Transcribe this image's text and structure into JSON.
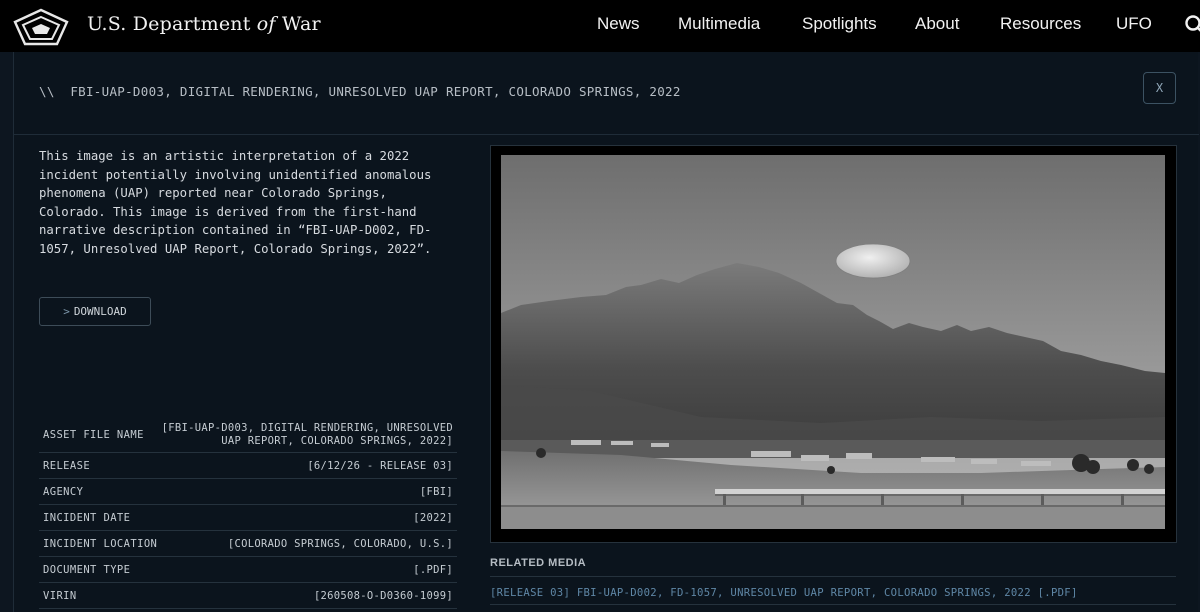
{
  "site": {
    "title_prefix": "U.S. Department ",
    "title_of": "of",
    "title_suffix": " War"
  },
  "nav": {
    "items": [
      "News",
      "Multimedia",
      "Spotlights",
      "About",
      "Resources",
      "UFO"
    ],
    "search_icon": "search-icon"
  },
  "modal": {
    "title_prefix": "\\\\",
    "title": "FBI-UAP-D003, DIGITAL RENDERING, UNRESOLVED UAP REPORT, COLORADO SPRINGS, 2022",
    "close_label": "X",
    "description": "This image is an artistic interpretation of a 2022 incident potentially involving unidentified anomalous phenomena (UAP) reported near Colorado Springs, Colorado. This image is derived from the first-hand narrative description contained in “FBI-UAP-D002, FD-1057, Unresolved UAP Report, Colorado Springs, 2022”.",
    "download_label": "DOWNLOAD",
    "download_chevron": ">",
    "metadata": [
      {
        "label": "ASSET FILE NAME",
        "value": "[FBI-UAP-D003, DIGITAL RENDERING, UNRESOLVED UAP REPORT, COLORADO SPRINGS, 2022]"
      },
      {
        "label": "RELEASE",
        "value": "[6/12/26 - RELEASE 03]"
      },
      {
        "label": "AGENCY",
        "value": "[FBI]"
      },
      {
        "label": "INCIDENT DATE",
        "value": "[2022]"
      },
      {
        "label": "INCIDENT LOCATION",
        "value": "[COLORADO SPRINGS, COLORADO, U.S.]"
      },
      {
        "label": "DOCUMENT TYPE",
        "value": "[.PDF]"
      },
      {
        "label": "VIRIN",
        "value": "[260508-O-D0360-1099]"
      }
    ],
    "related_title": "RELATED MEDIA",
    "related_link": "[RELEASE 03] FBI-UAP-D002, FD-1057, UNRESOLVED UAP REPORT, COLORADO SPRINGS, 2022 [.PDF]"
  },
  "colors": {
    "page_bg": "#0b131c",
    "topbar_bg": "#000000",
    "link": "#5f87a6",
    "accent_border": "#3c5262"
  }
}
